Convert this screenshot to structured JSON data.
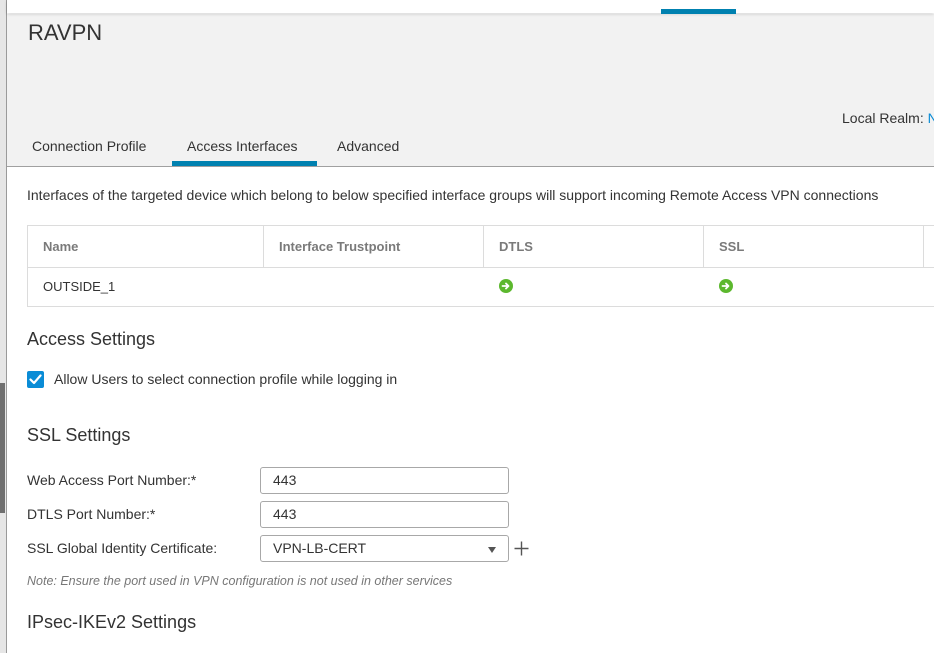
{
  "topbar": {
    "active_indicator": true
  },
  "header": {
    "title": "RAVPN",
    "local_realm_label": "Local Realm:",
    "local_realm_value": "N"
  },
  "tabs": [
    {
      "label": "Connection Profile",
      "active": false
    },
    {
      "label": "Access Interfaces",
      "active": true
    },
    {
      "label": "Advanced",
      "active": false
    }
  ],
  "description": "Interfaces of the targeted device which belong to below specified interface groups will support incoming Remote Access VPN connections",
  "interfaces_table": {
    "columns": [
      "Name",
      "Interface Trustpoint",
      "DTLS",
      "SSL"
    ],
    "rows": [
      {
        "name": "OUTSIDE_1",
        "trustpoint": "",
        "dtls": "enabled",
        "ssl": "enabled"
      }
    ]
  },
  "access_settings": {
    "title": "Access Settings",
    "allow_select_profile": {
      "label": "Allow Users to select connection profile while logging in",
      "checked": true
    }
  },
  "ssl_settings": {
    "title": "SSL Settings",
    "web_access_port": {
      "label": "Web Access Port Number:*",
      "value": "443"
    },
    "dtls_port": {
      "label": "DTLS Port Number:*",
      "value": "443"
    },
    "global_identity_cert": {
      "label": "SSL Global Identity Certificate:",
      "value": "VPN-LB-CERT"
    },
    "note": "Note: Ensure the port used in VPN configuration is not used in other services"
  },
  "ipsec_settings": {
    "title": "IPsec-IKEv2 Settings"
  },
  "colors": {
    "accent": "#0081b0",
    "link": "#0a8cd6",
    "status_enabled": "#5cb82e"
  }
}
